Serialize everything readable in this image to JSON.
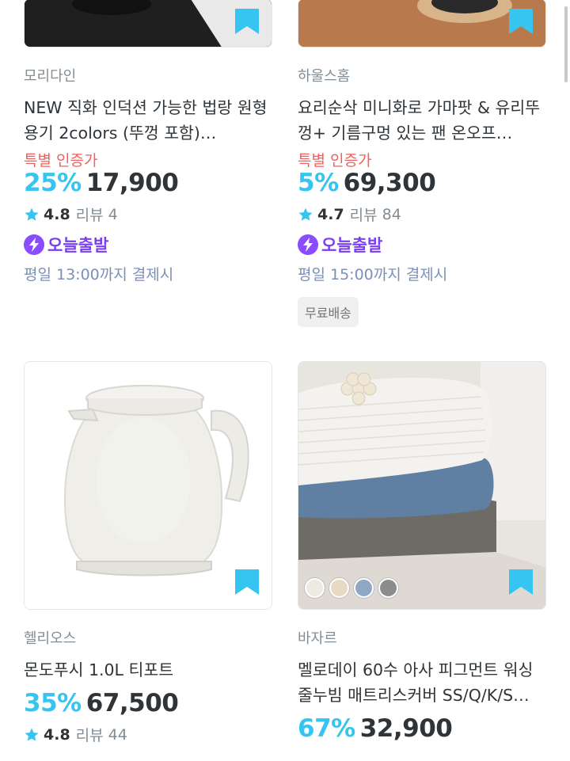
{
  "products": [
    {
      "brand": "모리다인",
      "title": "NEW 직화 인덕션 가능한 법랑 원형 용기 2colors (뚜껑 포함)…",
      "special": "특별 인증가",
      "discount": "25%",
      "price": "17,900",
      "rating": "4.8",
      "review_label": "리뷰",
      "review_count": "4",
      "today_label": "오늘출발",
      "deadline": "평일 13:00까지 결제시"
    },
    {
      "brand": "하울스홈",
      "title": "요리순삭 미니화로 가마팟 & 유리뚜껑+ 기름구멍 있는 팬 온오프…",
      "special": "특별 인증가",
      "discount": "5%",
      "price": "69,300",
      "rating": "4.7",
      "review_label": "리뷰",
      "review_count": "84",
      "today_label": "오늘출발",
      "deadline": "평일 15:00까지 결제시",
      "badge": "무료배송"
    },
    {
      "brand": "헬리오스",
      "title": "몬도푸시 1.0L 티포트",
      "discount": "35%",
      "price": "67,500",
      "rating": "4.8",
      "review_label": "리뷰",
      "review_count": "44"
    },
    {
      "brand": "바자르",
      "title": "멜로데이 60수 아사 피그먼트 워싱 줄누빔 매트리스커버 SS/Q/K/S…",
      "discount": "67%",
      "price": "32,900",
      "swatch_colors": [
        "#eeeae2",
        "#e8d9c2",
        "#8fa7c4",
        "#8c8c8c"
      ]
    }
  ],
  "colors": {
    "accent": "#35c5f0",
    "special": "#f25f5c",
    "today": "#7b3ff2",
    "deadline": "#7a90b8",
    "bookmark": "#35c5f0"
  }
}
